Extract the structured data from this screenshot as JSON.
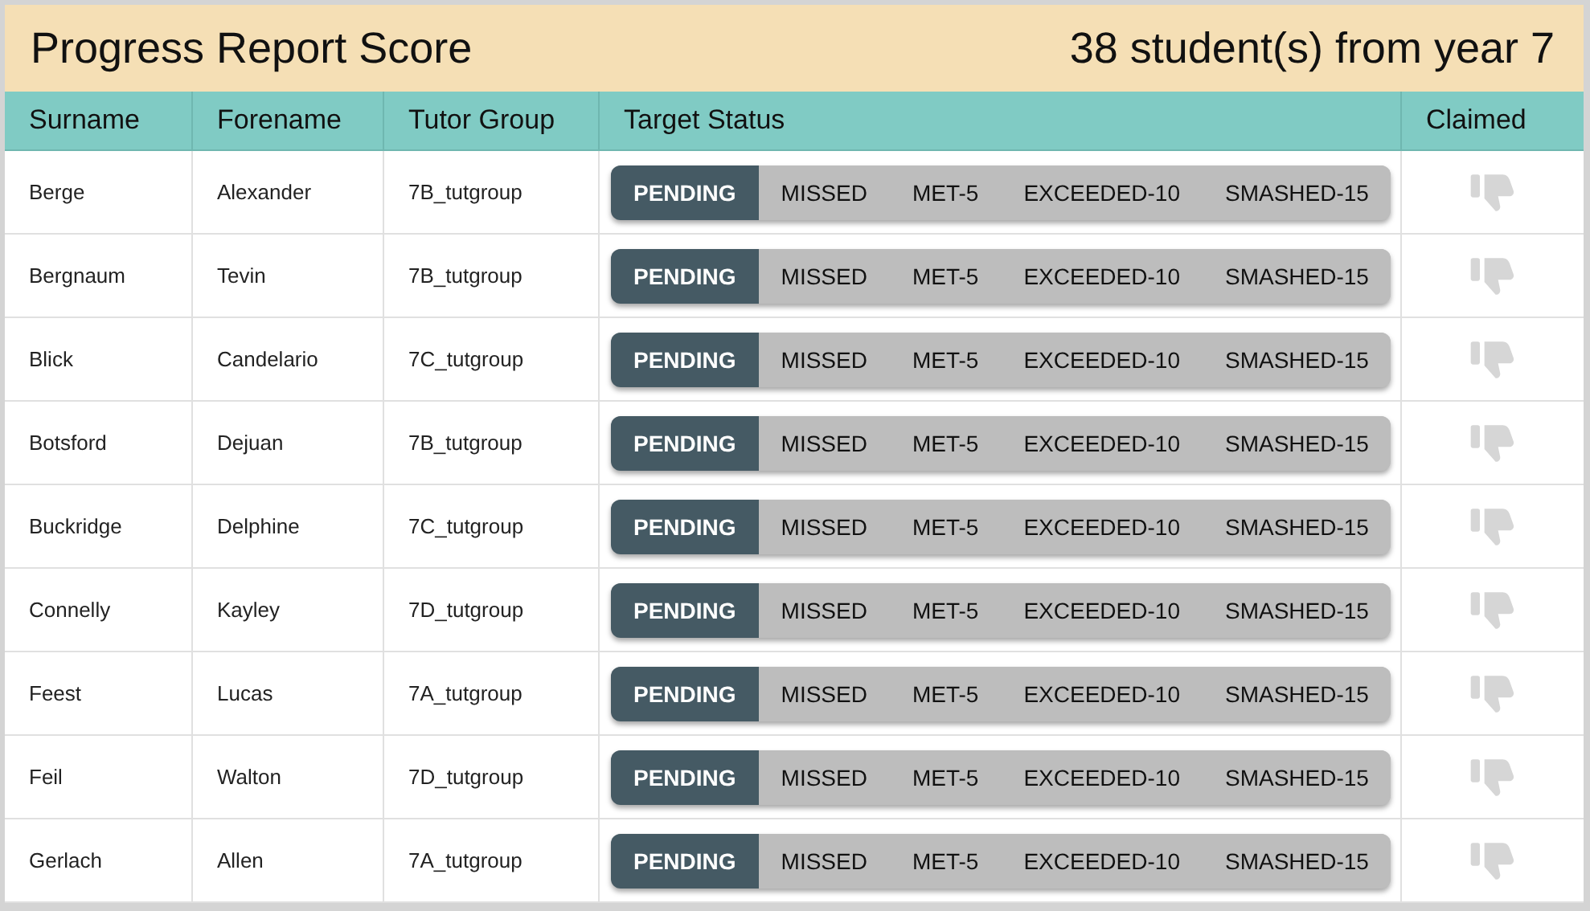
{
  "header": {
    "title": "Progress Report Score",
    "summary": "38 student(s) from year 7"
  },
  "columns": [
    "Surname",
    "Forename",
    "Tutor Group",
    "Target Status",
    "Claimed"
  ],
  "rows": [
    {
      "surname": "Berge",
      "forename": "Alexander",
      "tutor_group": "7B_tutgroup",
      "claimed": false,
      "status": [
        {
          "label": "PENDING",
          "selected": true
        },
        {
          "label": "MISSED",
          "selected": false
        },
        {
          "label": "MET-5",
          "selected": false
        },
        {
          "label": "EXCEEDED-10",
          "selected": false
        },
        {
          "label": "SMASHED-15",
          "selected": false
        }
      ]
    },
    {
      "surname": "Bergnaum",
      "forename": "Tevin",
      "tutor_group": "7B_tutgroup",
      "claimed": false,
      "status": [
        {
          "label": "PENDING",
          "selected": true
        },
        {
          "label": "MISSED",
          "selected": false
        },
        {
          "label": "MET-5",
          "selected": false
        },
        {
          "label": "EXCEEDED-10",
          "selected": false
        },
        {
          "label": "SMASHED-15",
          "selected": false
        }
      ]
    },
    {
      "surname": "Blick",
      "forename": "Candelario",
      "tutor_group": "7C_tutgroup",
      "claimed": false,
      "status": [
        {
          "label": "PENDING",
          "selected": true
        },
        {
          "label": "MISSED",
          "selected": false
        },
        {
          "label": "MET-5",
          "selected": false
        },
        {
          "label": "EXCEEDED-10",
          "selected": false
        },
        {
          "label": "SMASHED-15",
          "selected": false
        }
      ]
    },
    {
      "surname": "Botsford",
      "forename": "Dejuan",
      "tutor_group": "7B_tutgroup",
      "claimed": false,
      "status": [
        {
          "label": "PENDING",
          "selected": true
        },
        {
          "label": "MISSED",
          "selected": false
        },
        {
          "label": "MET-5",
          "selected": false
        },
        {
          "label": "EXCEEDED-10",
          "selected": false
        },
        {
          "label": "SMASHED-15",
          "selected": false
        }
      ]
    },
    {
      "surname": "Buckridge",
      "forename": "Delphine",
      "tutor_group": "7C_tutgroup",
      "claimed": false,
      "status": [
        {
          "label": "PENDING",
          "selected": true
        },
        {
          "label": "MISSED",
          "selected": false
        },
        {
          "label": "MET-5",
          "selected": false
        },
        {
          "label": "EXCEEDED-10",
          "selected": false
        },
        {
          "label": "SMASHED-15",
          "selected": false
        }
      ]
    },
    {
      "surname": "Connelly",
      "forename": "Kayley",
      "tutor_group": "7D_tutgroup",
      "claimed": false,
      "status": [
        {
          "label": "PENDING",
          "selected": true
        },
        {
          "label": "MISSED",
          "selected": false
        },
        {
          "label": "MET-5",
          "selected": false
        },
        {
          "label": "EXCEEDED-10",
          "selected": false
        },
        {
          "label": "SMASHED-15",
          "selected": false
        }
      ]
    },
    {
      "surname": "Feest",
      "forename": "Lucas",
      "tutor_group": "7A_tutgroup",
      "claimed": false,
      "status": [
        {
          "label": "PENDING",
          "selected": true
        },
        {
          "label": "MISSED",
          "selected": false
        },
        {
          "label": "MET-5",
          "selected": false
        },
        {
          "label": "EXCEEDED-10",
          "selected": false
        },
        {
          "label": "SMASHED-15",
          "selected": false
        }
      ]
    },
    {
      "surname": "Feil",
      "forename": "Walton",
      "tutor_group": "7D_tutgroup",
      "claimed": false,
      "status": [
        {
          "label": "PENDING",
          "selected": true
        },
        {
          "label": "MISSED",
          "selected": false
        },
        {
          "label": "MET-5",
          "selected": false
        },
        {
          "label": "EXCEEDED-10",
          "selected": false
        },
        {
          "label": "SMASHED-15",
          "selected": false
        }
      ]
    },
    {
      "surname": "Gerlach",
      "forename": "Allen",
      "tutor_group": "7A_tutgroup",
      "claimed": false,
      "status": [
        {
          "label": "PENDING",
          "selected": true
        },
        {
          "label": "MISSED",
          "selected": false
        },
        {
          "label": "MET-5",
          "selected": false
        },
        {
          "label": "EXCEEDED-10",
          "selected": false
        },
        {
          "label": "SMASHED-15",
          "selected": false
        }
      ]
    }
  ]
}
